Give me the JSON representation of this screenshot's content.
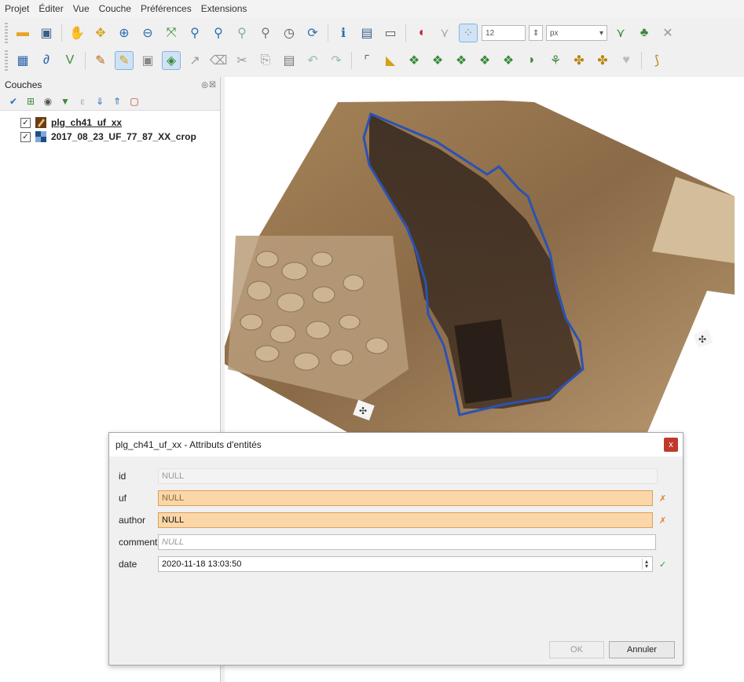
{
  "menu": [
    "Projet",
    "Éditer",
    "Vue",
    "Couche",
    "Préférences",
    "Extensions"
  ],
  "toolbar1": {
    "icons": [
      "open-project-icon",
      "save-project-icon",
      "pan-icon",
      "pan-to-selection-icon",
      "zoom-in-icon",
      "zoom-out-icon",
      "zoom-full-icon",
      "zoom-to-selection-icon",
      "zoom-to-layer-icon",
      "zoom-native-icon",
      "zoom-last-icon",
      "temporal-icon",
      "refresh-icon",
      "identify-icon",
      "attribute-table-icon",
      "measure-icon",
      "snapping-magnet-icon",
      "snapping-vertex-icon"
    ],
    "snap_tolerance": "12",
    "snap_unit": "px"
  },
  "toolbar2": {
    "icons": [
      "add-raster-icon",
      "digitize-icon",
      "vertex-tool-icon",
      "edit-pencil-icon",
      "toggle-editing-icon",
      "save-edits-icon",
      "add-polygon-icon",
      "vertex-tool-dropdown-icon",
      "delete-icon",
      "cut-icon",
      "copy-icon",
      "paste-icon",
      "undo-icon",
      "redo-icon",
      "digitize-curve-icon",
      "split-features-icon",
      "merge-icon",
      "reshape-icon",
      "offset-icon",
      "rotate-icon",
      "fill-ring-icon",
      "delete-ring-icon",
      "delete-part-icon",
      "add-ring-icon",
      "add-part-icon"
    ]
  },
  "layers_panel": {
    "title": "Couches",
    "header_controls": "◎☒",
    "layers": [
      {
        "name": "plg_ch41_uf_xx",
        "checked": "✓"
      },
      {
        "name": "2017_08_23_UF_77_87_XX_crop",
        "checked": "✓"
      }
    ]
  },
  "dialog": {
    "title": "plg_ch41_uf_xx - Attributs d'entités",
    "close": "x",
    "fields": [
      {
        "label": "id",
        "value": "NULL"
      },
      {
        "label": "uf",
        "value": "NULL",
        "mark": "✗"
      },
      {
        "label": "author",
        "value": "NULL",
        "mark": "✗"
      },
      {
        "label": "comment",
        "value": "NULL"
      },
      {
        "label": "date",
        "value": "2020-11-18 13:03:50",
        "mark": "✓"
      }
    ],
    "ok_label": "OK",
    "cancel_label": "Annuler"
  },
  "colors": {
    "required_field": "#fbd6a8",
    "polygon_outline": "#2b52b5",
    "close_button": "#c0392b"
  }
}
